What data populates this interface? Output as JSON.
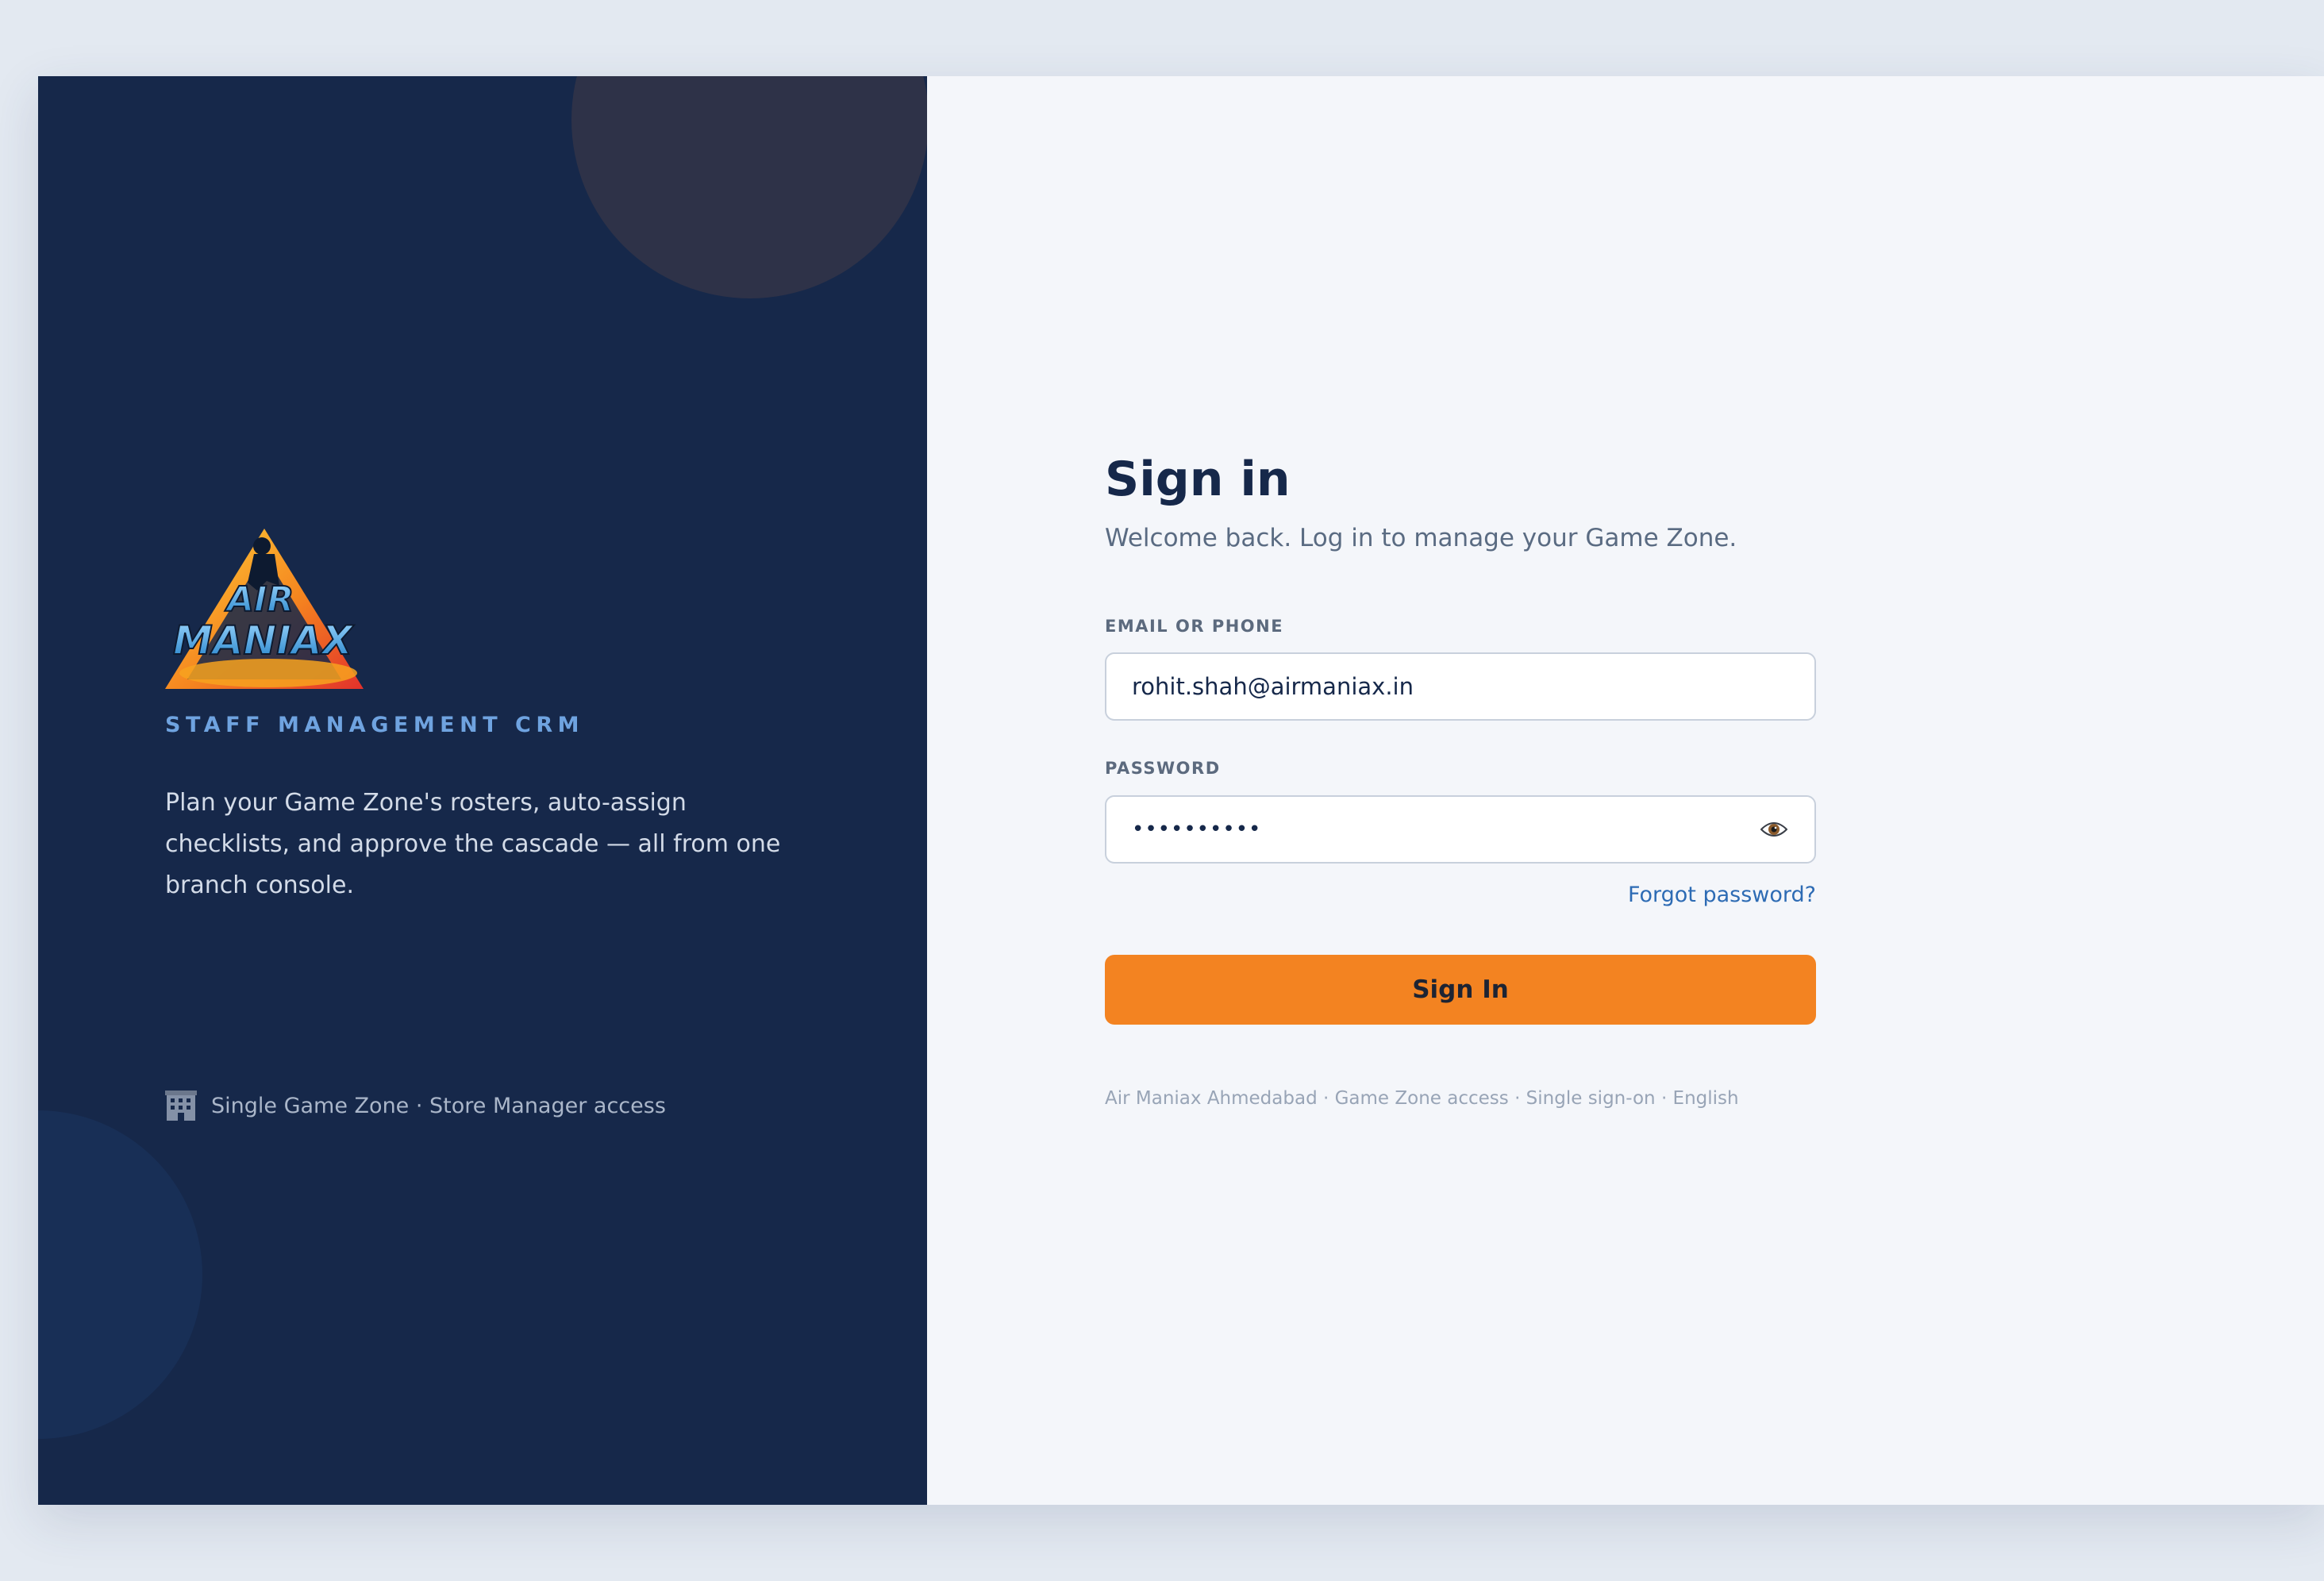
{
  "brand": {
    "tagline": "STAFF MANAGEMENT CRM",
    "description": "Plan your Game Zone's rosters, auto-assign checklists, and approve the cascade — all from one branch console.",
    "access_note": "Single Game Zone · Store Manager access",
    "logo_alt": "Air Maniax logo",
    "logo_text_line1": "AIR",
    "logo_text_line2": "MANIAX",
    "accent_color": "#f38321",
    "panel_color": "#16284a"
  },
  "signin": {
    "title": "Sign in",
    "subtitle": "Welcome back. Log in to manage your Game Zone.",
    "email_label": "EMAIL OR PHONE",
    "email_value": "rohit.shah@airmaniax.in",
    "password_label": "PASSWORD",
    "password_masked": "••••••••••",
    "password_toggle_icon": "eye-icon",
    "forgot_link": "Forgot password?",
    "submit_label": "Sign In",
    "footer": "Air Maniax Ahmedabad · Game Zone access · Single sign-on · English"
  }
}
